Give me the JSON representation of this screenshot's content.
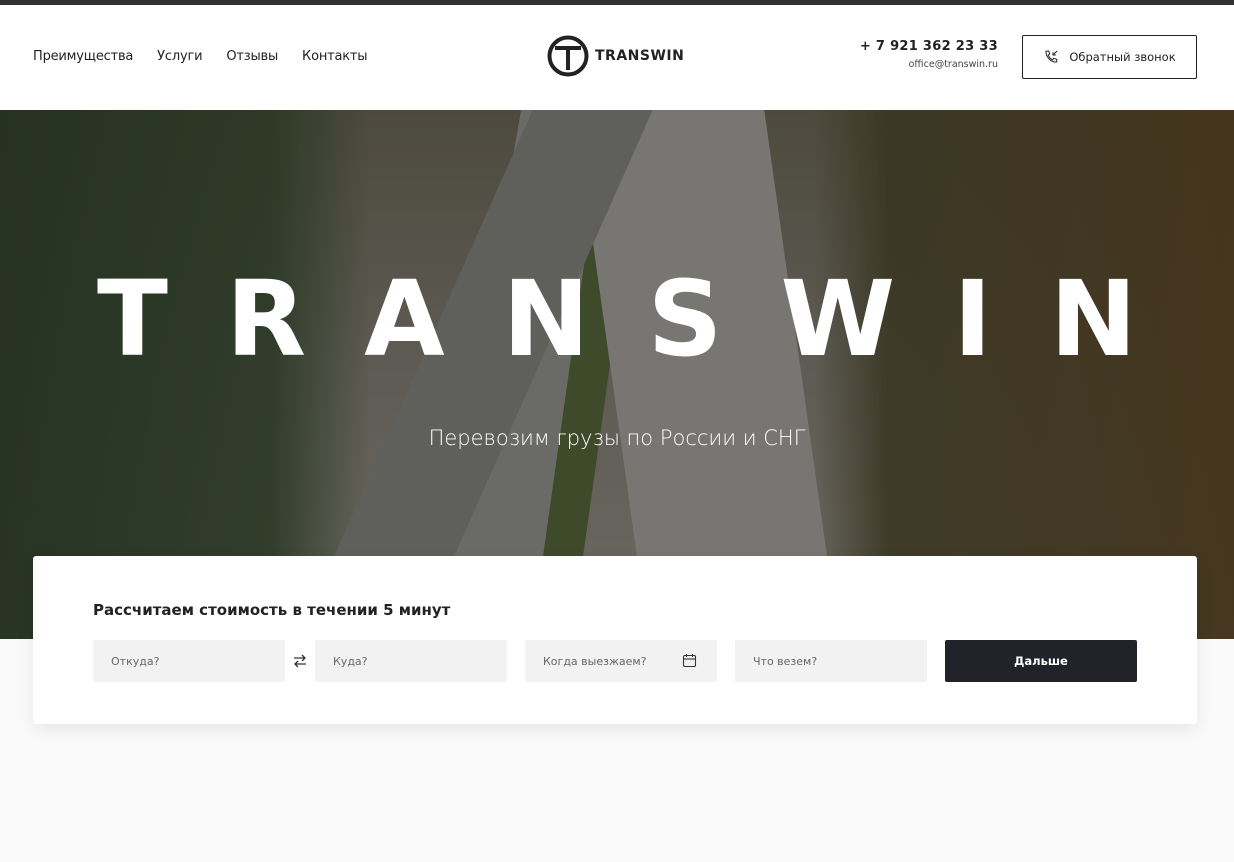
{
  "header": {
    "nav": [
      "Преимущества",
      "Услуги",
      "Отзывы",
      "Контакты"
    ],
    "logo_text": "TRANSWIN",
    "phone": "+ 7 921 362 23 33",
    "email": "office@transwin.ru",
    "callback_label": "Обратный звонок"
  },
  "hero": {
    "title": "TRANSWIN",
    "subtitle": "Перевозим грузы по России и СНГ"
  },
  "calculator": {
    "title": "Рассчитаем стоимость в течении 5 минут",
    "from_placeholder": "Откуда?",
    "to_placeholder": "Куда?",
    "date_placeholder": "Когда выезжаем?",
    "cargo_placeholder": "Что везем?",
    "submit_label": "Дальше"
  },
  "colors": {
    "dark": "#22222a",
    "field_bg": "#f2f2f2"
  }
}
